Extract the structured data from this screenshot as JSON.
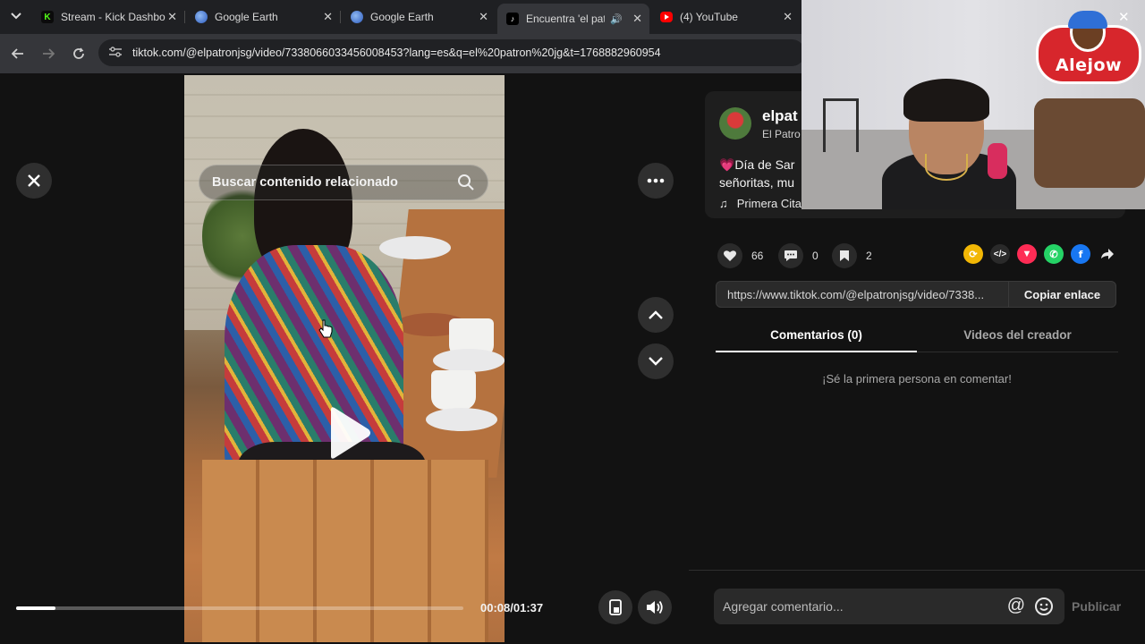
{
  "browser": {
    "tabs": [
      {
        "label": "Stream - Kick Dashbo",
        "icon": "kick-icon",
        "color": "#53fc18"
      },
      {
        "label": "Google Earth",
        "icon": "google-earth-icon",
        "color": "#4a7bd9"
      },
      {
        "label": "Google Earth",
        "icon": "google-earth-icon",
        "color": "#4a7bd9"
      },
      {
        "label": "Encuentra 'el patr",
        "icon": "tiktok-icon",
        "active": true,
        "audio": true
      },
      {
        "label": "(4) YouTube",
        "icon": "youtube-icon",
        "color": "#ff0000"
      }
    ],
    "url": "tiktok.com/@elpatronjsg/video/7338066033456008453?lang=es&q=el%20patron%20jg&t=1768882960954"
  },
  "player": {
    "search_placeholder": "Buscar contenido relacionado",
    "time": "00:08/01:37",
    "progress_fraction": 0.087
  },
  "video_info": {
    "username": "elpat",
    "nickname": "El Patro",
    "caption": "💗Día de Sar señoritas, mu",
    "music": "Primera Cita",
    "likes": "66",
    "comments": "0",
    "saves": "2",
    "link": "https://www.tiktok.com/@elpatronjsg/video/7338...",
    "copy_link_label": "Copiar enlace"
  },
  "comments_panel": {
    "tab_comments": "Comentarios (0)",
    "tab_creator_videos": "Videos del creador",
    "empty_message": "¡Sé la primera persona en comentar!",
    "input_placeholder": "Agregar comentario...",
    "publish_label": "Publicar"
  },
  "webcam": {
    "logo_text": "Alejow"
  },
  "colors": {
    "background": "#121212",
    "accent": "#fe2c55"
  }
}
